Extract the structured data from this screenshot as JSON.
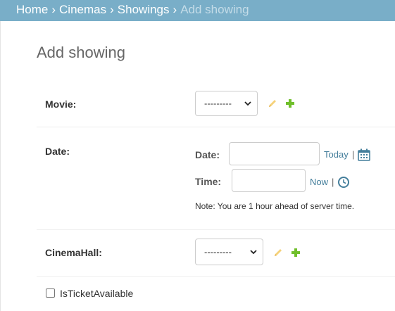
{
  "breadcrumbs": {
    "items": [
      "Home",
      "Cinemas",
      "Showings"
    ],
    "separator": "›",
    "current": "Add showing"
  },
  "page": {
    "title": "Add showing"
  },
  "form": {
    "movie": {
      "label": "Movie:",
      "selected": "---------"
    },
    "date": {
      "label": "Date:",
      "date_label": "Date:",
      "date_value": "",
      "today_link": "Today",
      "time_label": "Time:",
      "time_value": "",
      "now_link": "Now",
      "pipe": "|",
      "note": "Note: You are 1 hour ahead of server time."
    },
    "cinema_hall": {
      "label": "CinemaHall:",
      "selected": "---------"
    },
    "is_ticket_available": {
      "label": "IsTicketAvailable",
      "checked": false
    }
  },
  "colors": {
    "header_bg": "#79aec8",
    "link": "#447e9b",
    "edit_icon": "#efb80b",
    "add_icon": "#70bf2b"
  }
}
